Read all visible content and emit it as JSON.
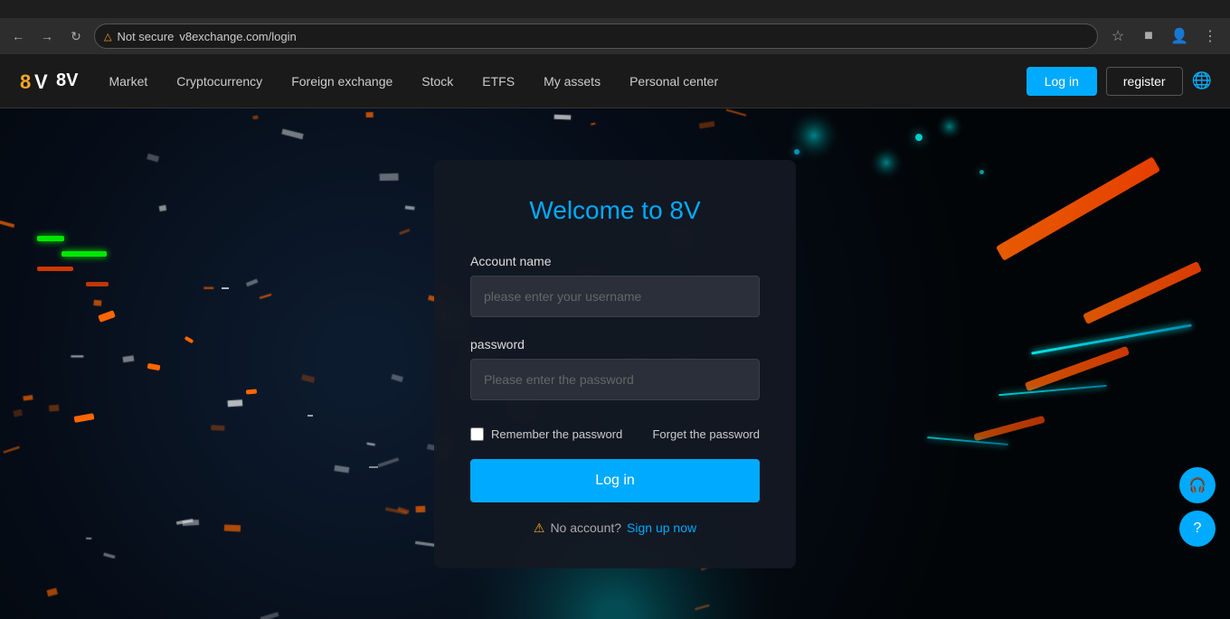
{
  "browser": {
    "url": "v8exchange.com/login",
    "security_label": "Not secure"
  },
  "header": {
    "logo_text": "8V",
    "nav_items": [
      {
        "label": "Market"
      },
      {
        "label": "Cryptocurrency"
      },
      {
        "label": "Foreign exchange"
      },
      {
        "label": "Stock"
      },
      {
        "label": "ETFS"
      },
      {
        "label": "My assets"
      },
      {
        "label": "Personal center"
      }
    ],
    "login_label": "Log in",
    "register_label": "register"
  },
  "login_card": {
    "title": "Welcome to 8V",
    "account_label": "Account name",
    "username_placeholder": "please enter your username",
    "password_label": "password",
    "password_placeholder": "Please enter the password",
    "remember_label": "Remember the password",
    "forget_label": "Forget the password",
    "submit_label": "Log in",
    "no_account_label": "No account?",
    "signup_label": "Sign up now"
  },
  "colors": {
    "accent": "#00aaff",
    "brand_orange": "#f5a623",
    "bg_dark": "#0a0e17",
    "card_bg": "rgba(20,25,35,0.92)"
  }
}
